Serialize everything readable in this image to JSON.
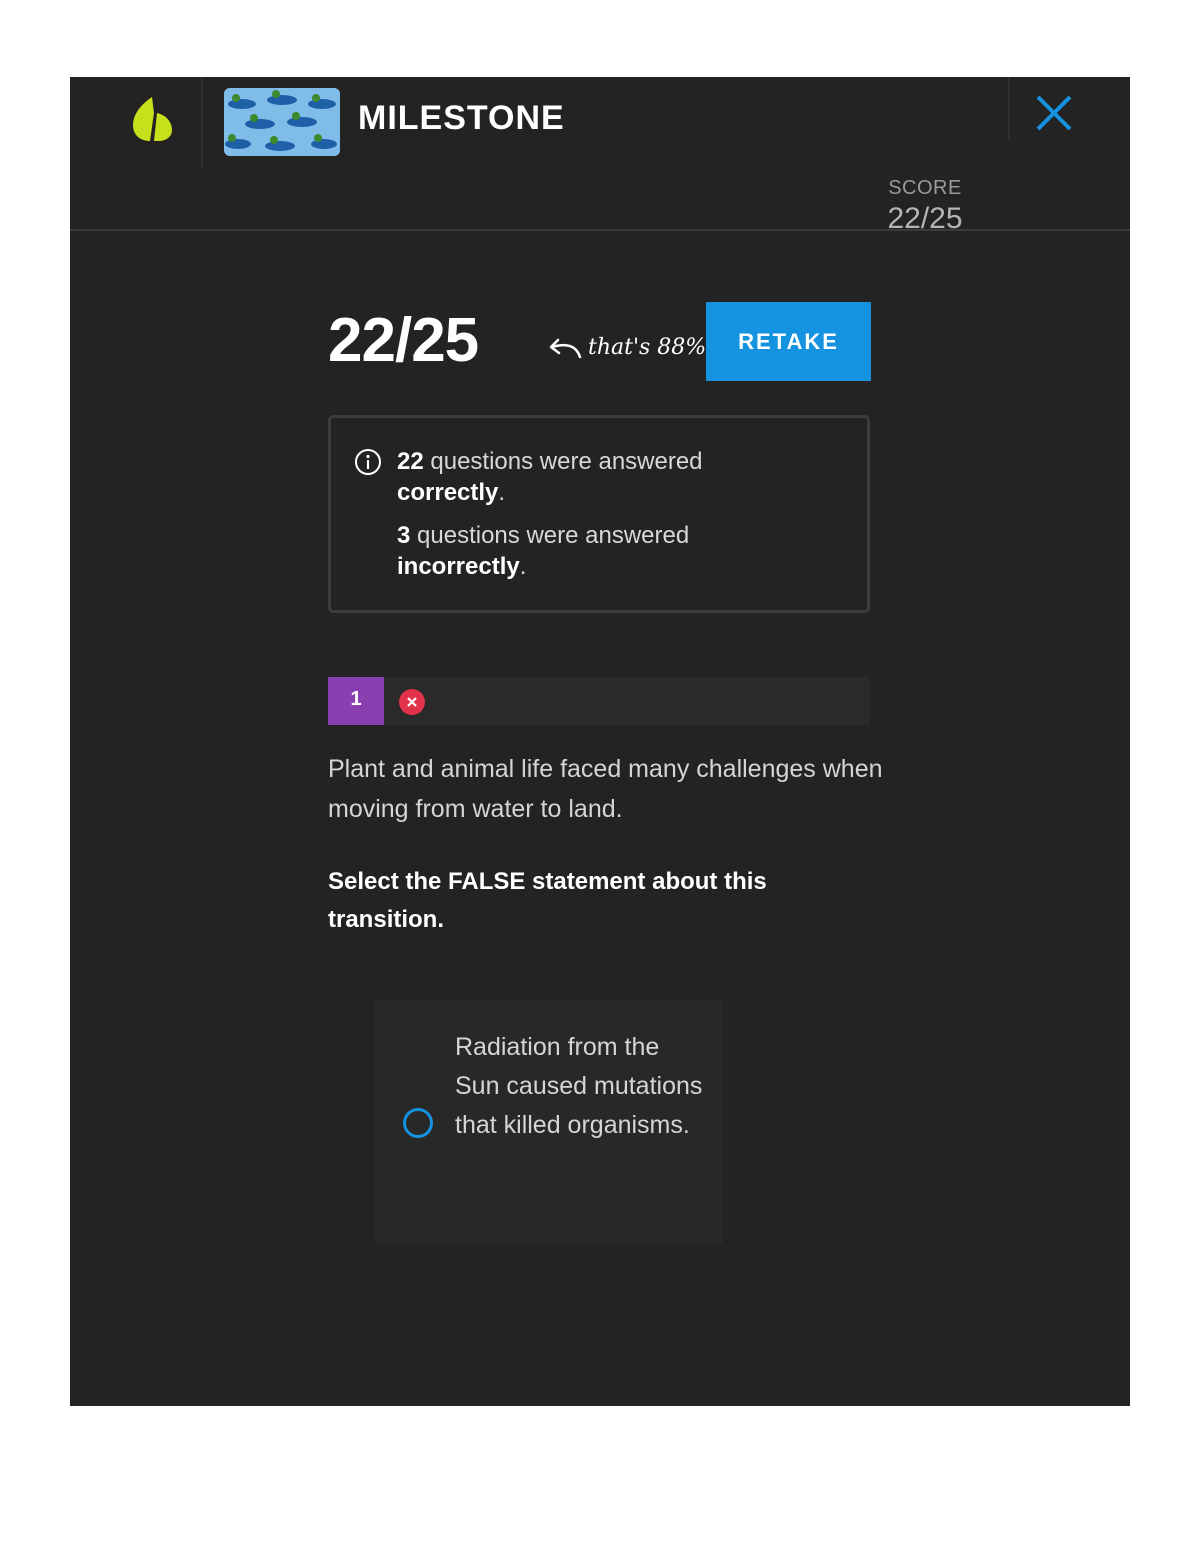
{
  "header": {
    "title": "MILESTONE",
    "score_label": "SCORE",
    "score_value": "22/25"
  },
  "results": {
    "big_score": "22/25",
    "note": "that's 88%",
    "retake_label": "RETAKE",
    "correct_count": "22",
    "correct_text": "questions were answered",
    "correct_word": "correctly",
    "incorrect_count": "3",
    "incorrect_text": "questions were answered",
    "incorrect_word": "incorrectly"
  },
  "question": {
    "number": "1",
    "status": "incorrect",
    "prompt": "Plant and animal life faced many challenges when moving from water to land.",
    "instruction": "Select the FALSE statement about this transition.",
    "option": "Radiation from the Sun caused mutations that killed organisms."
  },
  "colors": {
    "accent": "#1592e0",
    "logo": "#c6e01b",
    "question_badge": "#8a3fb0",
    "incorrect": "#e0334b",
    "background": "#232323"
  },
  "icons": {
    "logo": "sophia-logo-icon",
    "close": "close-icon",
    "info": "info-icon",
    "status": "incorrect-icon",
    "arrow": "curved-arrow-icon"
  }
}
